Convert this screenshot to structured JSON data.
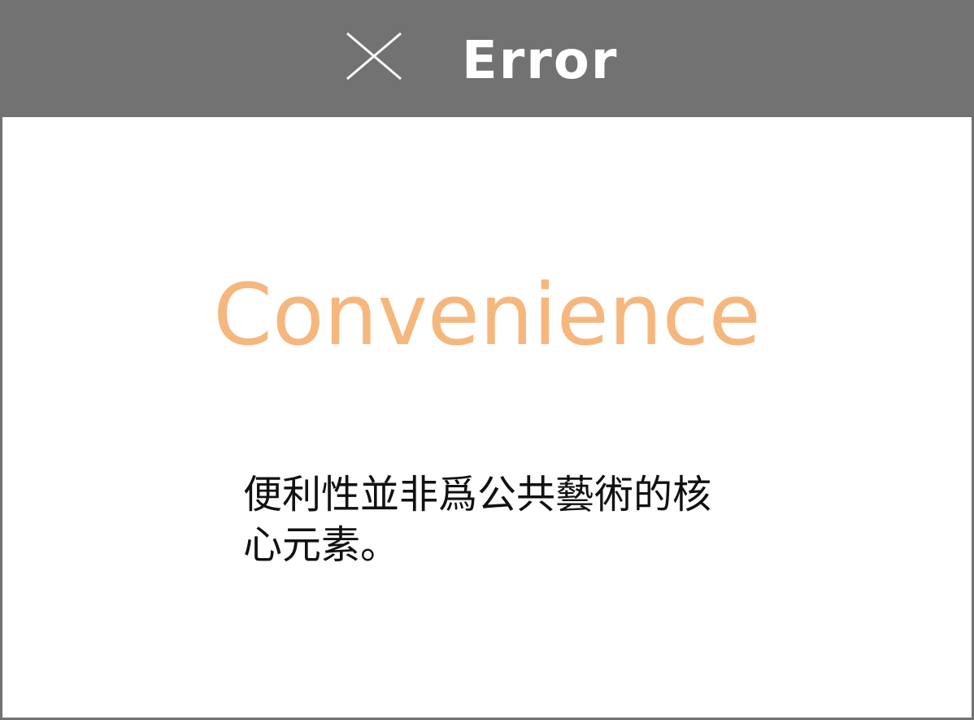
{
  "dialog": {
    "title": "Error",
    "close_icon": "close-icon",
    "headline": "Convenience",
    "message": "便利性並非爲公共藝術的核心元素。"
  },
  "colors": {
    "title_bar": "#727272",
    "title_text": "#ffffff",
    "headline": "#f6b77e",
    "message": "#111111",
    "border": "#727272"
  }
}
